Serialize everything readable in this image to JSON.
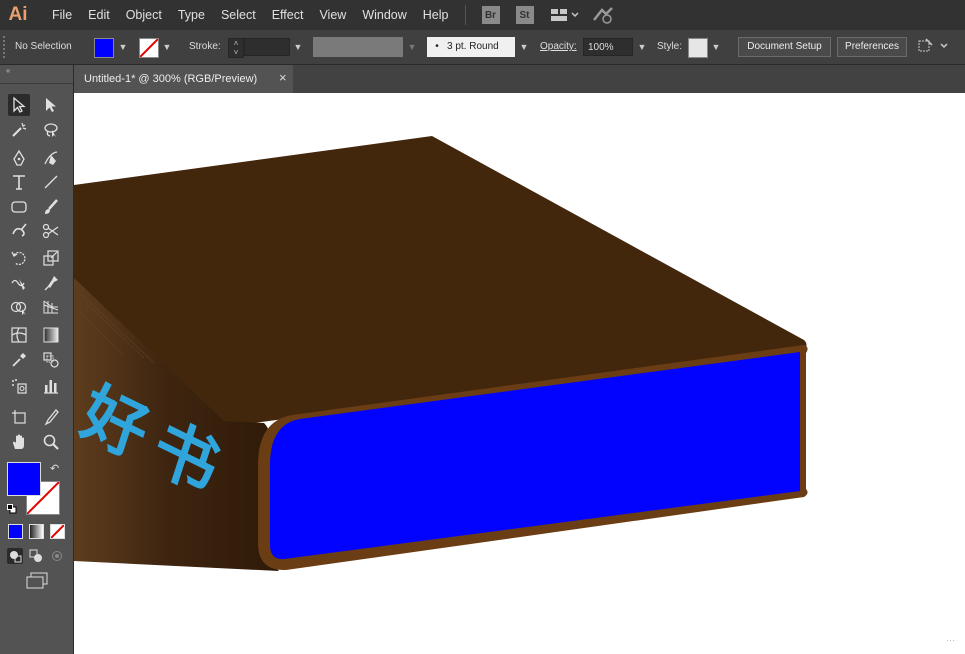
{
  "app": {
    "logo": "Ai"
  },
  "menu": [
    "File",
    "Edit",
    "Object",
    "Type",
    "Select",
    "Effect",
    "View",
    "Window",
    "Help"
  ],
  "bridge": {
    "br": "Br",
    "st": "St"
  },
  "control": {
    "selection": "No Selection",
    "stroke_label": "Stroke:",
    "brush": "3 pt. Round",
    "opacity_label": "Opacity:",
    "opacity_value": "100%",
    "style_label": "Style:",
    "document_setup": "Document Setup",
    "preferences": "Preferences"
  },
  "document": {
    "tab_title": "Untitled-1* @ 300% (RGB/Preview)",
    "close": "×"
  },
  "colors": {
    "fill": "#0000ff",
    "cover": "#43270d",
    "pages": "#0202ff",
    "title_text": "#2fa5dc"
  },
  "artwork": {
    "spine_text": "好书"
  },
  "tools": [
    "selection-tool",
    "direct-selection-tool",
    "magic-wand-tool",
    "lasso-tool",
    "pen-tool",
    "curvature-tool",
    "type-tool",
    "line-tool",
    "rectangle-tool",
    "paintbrush-tool",
    "shaper-tool",
    "scissors-tool",
    "rotate-tool",
    "scale-tool",
    "warp-tool",
    "puppet-warp-tool",
    "shape-builder-tool",
    "perspective-grid-tool",
    "mesh-tool",
    "gradient-tool",
    "eyedropper-tool",
    "blend-tool",
    "symbol-sprayer-tool",
    "column-graph-tool",
    "artboard-tool",
    "slice-tool",
    "hand-tool",
    "zoom-tool"
  ]
}
